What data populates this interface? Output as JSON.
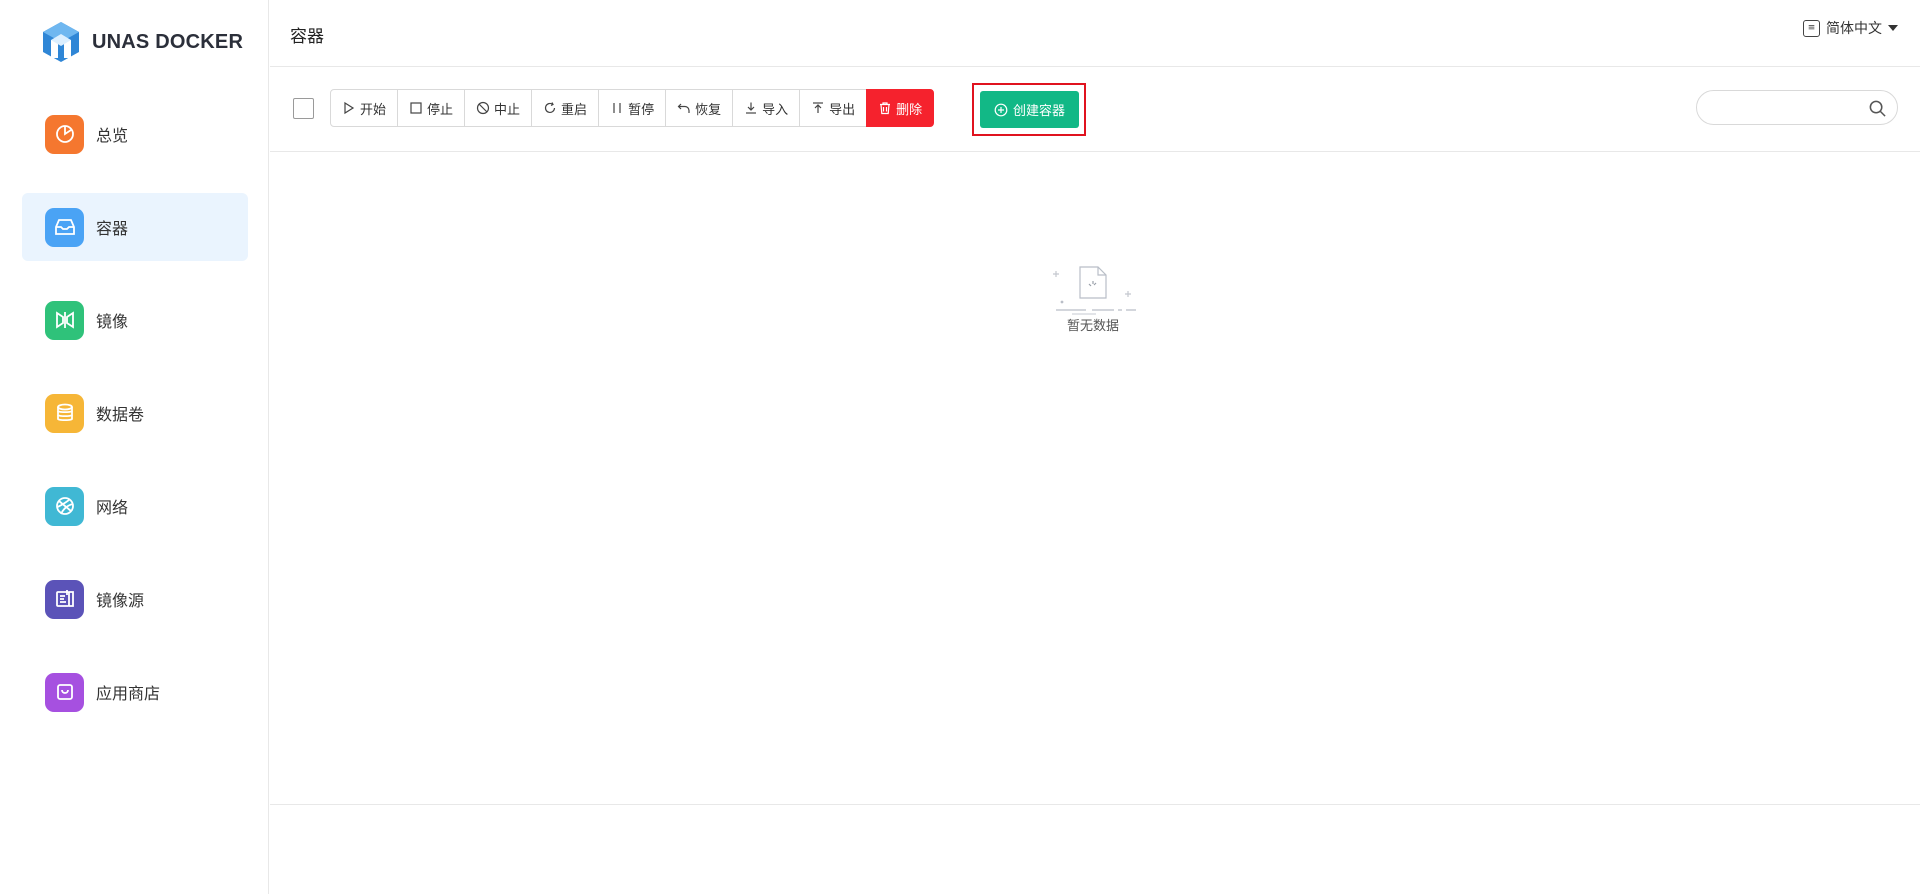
{
  "app": {
    "brand": "UNAS DOCKER"
  },
  "sidebar": {
    "items": [
      {
        "label": "总览",
        "icon": "overview-icon",
        "color": "#f5772f",
        "active": false
      },
      {
        "label": "容器",
        "icon": "container-icon",
        "color": "#4aa3f5",
        "active": true
      },
      {
        "label": "镜像",
        "icon": "image-icon",
        "color": "#2fc27a",
        "active": false
      },
      {
        "label": "数据卷",
        "icon": "volume-icon",
        "color": "#f6b637",
        "active": false
      },
      {
        "label": "网络",
        "icon": "network-icon",
        "color": "#40b8d4",
        "active": false
      },
      {
        "label": "镜像源",
        "icon": "registry-icon",
        "color": "#5b53b8",
        "active": false
      },
      {
        "label": "应用商店",
        "icon": "app-store-icon",
        "color": "#a650e0",
        "active": false
      }
    ]
  },
  "header": {
    "title": "容器",
    "language": "简体中文"
  },
  "toolbar": {
    "buttons": [
      {
        "label": "开始",
        "icon": "play-icon"
      },
      {
        "label": "停止",
        "icon": "stop-icon"
      },
      {
        "label": "中止",
        "icon": "ban-icon"
      },
      {
        "label": "重启",
        "icon": "restart-icon"
      },
      {
        "label": "暂停",
        "icon": "pause-icon"
      },
      {
        "label": "恢复",
        "icon": "undo-icon"
      },
      {
        "label": "导入",
        "icon": "download-icon"
      },
      {
        "label": "导出",
        "icon": "upload-icon"
      },
      {
        "label": "删除",
        "icon": "trash-icon"
      }
    ],
    "create_label": "创建容器",
    "search_placeholder": ""
  },
  "content": {
    "empty_text": "暂无数据"
  },
  "colors": {
    "danger": "#f5222d",
    "primary": "#12b886",
    "highlight_border": "#e0131f",
    "active_bg": "#eaf4fe"
  }
}
